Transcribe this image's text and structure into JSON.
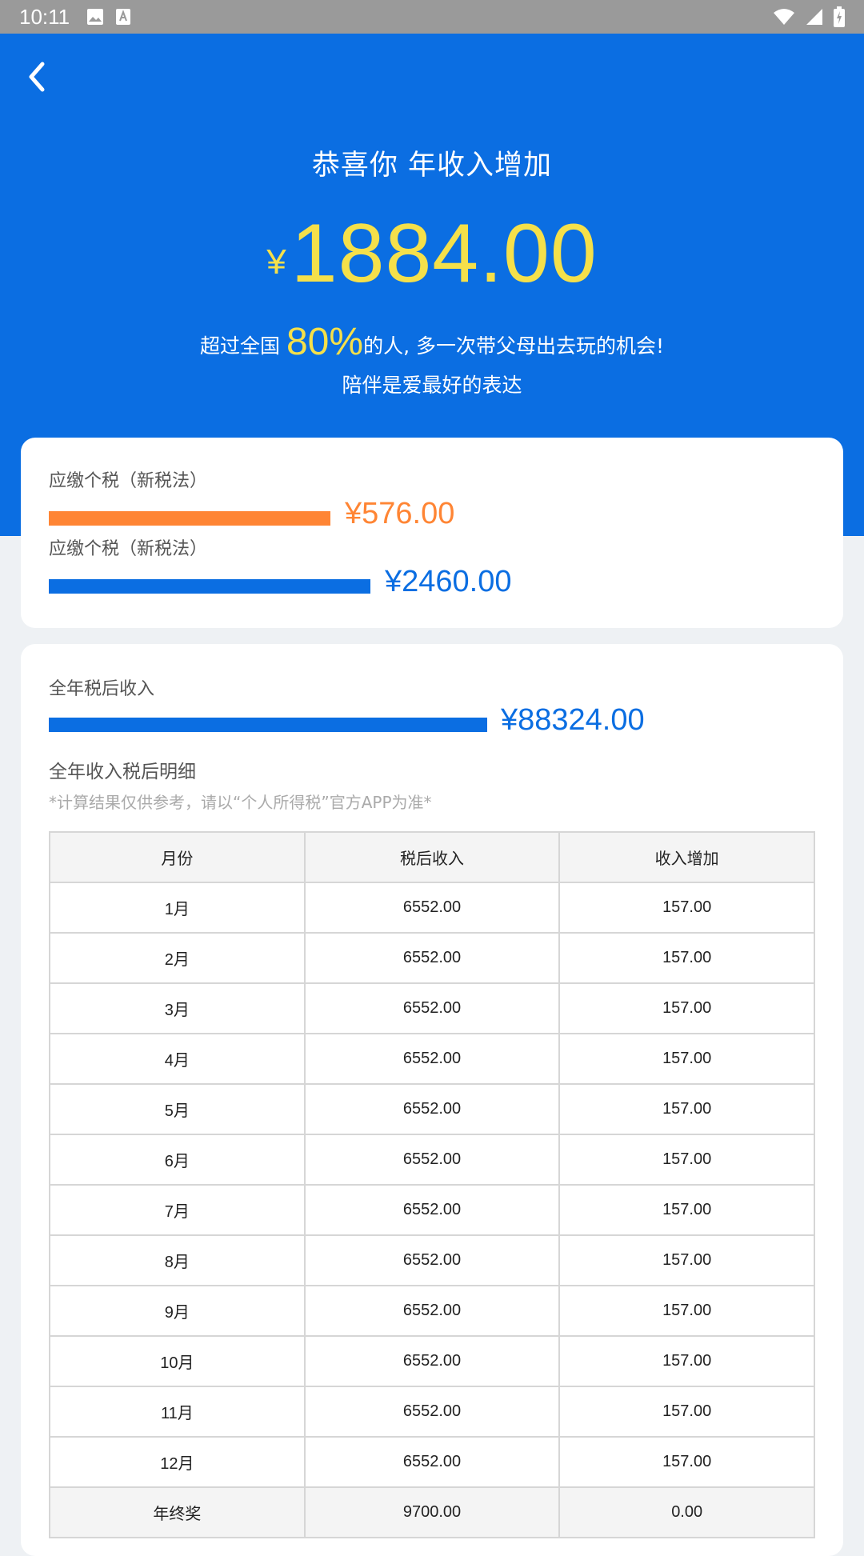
{
  "status_bar": {
    "time": "10:11"
  },
  "header": {
    "title": "恭喜你 年收入增加",
    "currency_symbol": "¥",
    "amount": "1884.00",
    "line1_prefix": "超过全国",
    "percent": "80%",
    "line1_suffix": "的人, 多一次带父母出去玩的机会!",
    "line2": "陪伴是爱最好的表达"
  },
  "tax": {
    "new_label": "应缴个税（新税法）",
    "new_value": "¥576.00",
    "old_label": "应缴个税（新税法）",
    "old_value": "¥2460.00"
  },
  "income": {
    "label": "全年税后收入",
    "value": "¥88324.00",
    "detail_title": "全年收入税后明细",
    "note": "*计算结果仅供参考，请以“个人所得税”官方APP为准*"
  },
  "table": {
    "columns": [
      "月份",
      "税后收入",
      "收入增加"
    ],
    "rows": [
      [
        "1月",
        "6552.00",
        "157.00"
      ],
      [
        "2月",
        "6552.00",
        "157.00"
      ],
      [
        "3月",
        "6552.00",
        "157.00"
      ],
      [
        "4月",
        "6552.00",
        "157.00"
      ],
      [
        "5月",
        "6552.00",
        "157.00"
      ],
      [
        "6月",
        "6552.00",
        "157.00"
      ],
      [
        "7月",
        "6552.00",
        "157.00"
      ],
      [
        "8月",
        "6552.00",
        "157.00"
      ],
      [
        "9月",
        "6552.00",
        "157.00"
      ],
      [
        "10月",
        "6552.00",
        "157.00"
      ],
      [
        "11月",
        "6552.00",
        "157.00"
      ],
      [
        "12月",
        "6552.00",
        "157.00"
      ],
      [
        "年终奖",
        "9700.00",
        "0.00"
      ]
    ]
  },
  "colors": {
    "primary_blue": "#0b6ee2",
    "highlight_yellow": "#f5e04a",
    "orange": "#ff8534"
  }
}
